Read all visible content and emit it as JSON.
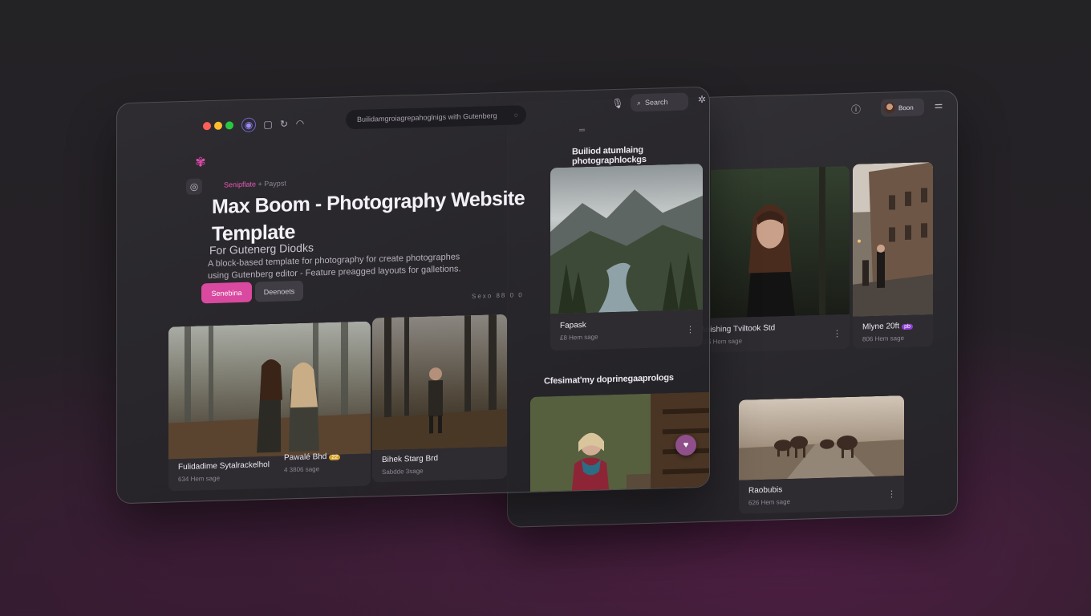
{
  "browser": {
    "url": "Builidamgroiagrepahoglnigs with Gutenberg",
    "search_label": "Search",
    "user_name": "Boon"
  },
  "hero": {
    "breadcrumb_accent": "Senipflate",
    "breadcrumb_rest": "+ Paypst",
    "title": "Max Boom - Photography Website Template",
    "subheading": "For Gutenerg Diodks",
    "description": "A block-based template for photography for create photographes using Gutenberg editor - Feature preagged layouts for galletions.",
    "primary_button": "Senebina",
    "secondary_button": "Deenoets",
    "view_controls": "Sexo 88 0 0"
  },
  "gallery_cards": [
    {
      "title": "Fulidadime Sytalrackelhol",
      "meta": "634 Hem sage"
    },
    {
      "title": "Pawalé Bhd",
      "meta": "4 3806 sage",
      "badge": "22"
    },
    {
      "title": "Bihek Starg Brd",
      "meta": "Sabdde 3sage"
    }
  ],
  "featured": {
    "heading": "Builiod atumlaing photographlockgs",
    "cards": [
      {
        "title": "Fapask",
        "meta": "£8 Hem sage"
      },
      {
        "title": "Anishing Tviltook Std",
        "meta": "685 Hem sage"
      },
      {
        "title": "Mlyne 20ft",
        "meta": "806 Hem sage",
        "badge": "pb"
      }
    ]
  },
  "collections": {
    "heading": "Cfesimat'my doprinegaaprologs",
    "cards": [
      {
        "title": "",
        "meta": ""
      },
      {
        "title": "Raobubis",
        "meta": "626 Hem sage"
      }
    ]
  },
  "icons": {
    "logo": "flower-logo-icon",
    "mic": "microphone-icon",
    "settings": "sliders-icon"
  },
  "colors": {
    "accent": "#d9499f",
    "dot_red": "#ff5f57",
    "dot_yellow": "#febc2e",
    "dot_green": "#28c840"
  }
}
